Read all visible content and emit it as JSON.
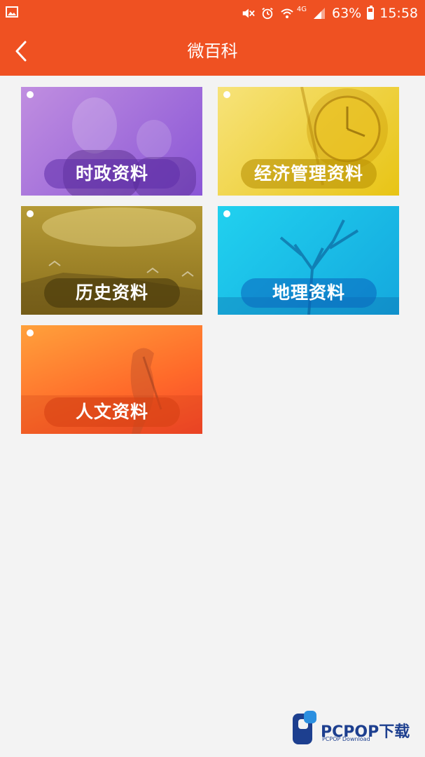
{
  "status_bar": {
    "network": "4G",
    "battery_percent": "63%",
    "time": "15:58"
  },
  "app_bar": {
    "title": "微百科",
    "background": "#ef5122"
  },
  "categories": [
    {
      "label": "时政资料",
      "color": "#8a56d6"
    },
    {
      "label": "经济管理资料",
      "color": "#e8c415"
    },
    {
      "label": "历史资料",
      "color": "#8a6f1c"
    },
    {
      "label": "地理资料",
      "color": "#14a8de"
    },
    {
      "label": "人文资料",
      "color": "#ff6a2a"
    }
  ],
  "watermark": {
    "brand": "PCPOP下载",
    "sub": "PCPOP Download"
  }
}
